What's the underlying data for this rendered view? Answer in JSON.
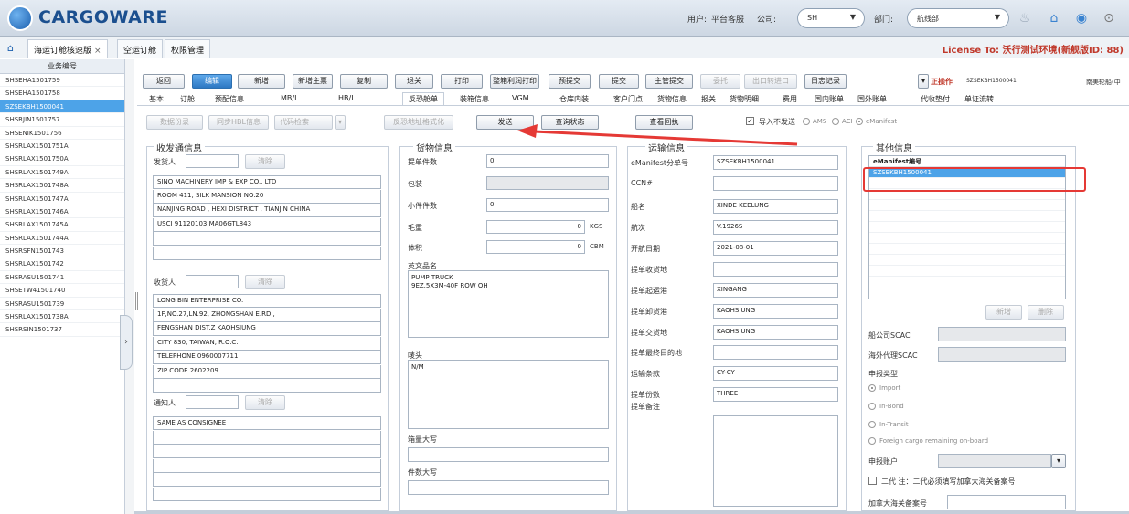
{
  "app": {
    "name": "CARGOWARE"
  },
  "topbar": {
    "user_label": "用户:",
    "user_value": "平台客服",
    "company_label": "公司:",
    "company_value": "SH",
    "dept_label": "部门:",
    "dept_value": "航线部"
  },
  "tabs": [
    {
      "label": "海运订舱核速版"
    },
    {
      "label": "空运订舱"
    },
    {
      "label": "权限管理"
    }
  ],
  "license": "License To: 沃行测试环境(新舰版ID: 88)",
  "left_list": {
    "header": "业务编号",
    "rows": [
      "SHSEHA1501759",
      "SHSEHA1501758",
      "SZSEKBH1500041",
      "SHSRJIN1501757",
      "SHSENIK1501756",
      "SHSRLAX1501751A",
      "SHSRLAX1501750A",
      "SHSRLAX1501749A",
      "SHSRLAX1501748A",
      "SHSRLAX1501747A",
      "SHSRLAX1501746A",
      "SHSRLAX1501745A",
      "SHSRLAX1501744A",
      "SHSRSFN1501743",
      "SHSRLAX1501742",
      "SHSRASU1501741",
      "SHSETW41501740",
      "SHSRASU1501739",
      "SHSRLAX1501738A",
      "SHSRSIN1501737"
    ],
    "selected_index": 2
  },
  "toolbar": {
    "buttons": [
      "返回",
      "编辑",
      "新增",
      "新增主票",
      "复制",
      "退关",
      "打印",
      "整箱利润打印",
      "预提交",
      "提交",
      "主管提交",
      "委托",
      "出口转进口",
      "日志记录"
    ],
    "op_label": "正操作",
    "ref": "SZSEKBH1500041",
    "carrier": "南美轮船(中"
  },
  "subtabs": [
    "基本",
    "订舱",
    "预配信息",
    "MB/L",
    "HB/L",
    "反恐舱单",
    "装箱信息",
    "VGM",
    "仓库内装",
    "客户门点",
    "货物信息",
    "报关",
    "货物明细",
    "费用",
    "国内账单",
    "国外账单",
    "代收垫付",
    "单证流转"
  ],
  "action_bar": {
    "btn_data": "数据份录",
    "btn_sync": "同步HBL信息",
    "btn_code": "代码检索",
    "btn_format": "反恐地址格式化",
    "btn_send": "发送",
    "btn_query": "查询状态",
    "btn_receipt": "查看回执",
    "chk_label": "导入不发送",
    "radio_ams": "AMS",
    "radio_aci": "ACI",
    "radio_emanifest": "eManifest"
  },
  "shipper_section": {
    "title": "收发通信息",
    "shipper_label": "发货人",
    "clear": "清除",
    "shipper_lines": [
      "SINO MACHINERY IMP & EXP CO., LTD",
      "ROOM 411, SILK MANSION NO.20",
      "NANJING ROAD , HEXI DISTRICT , TIANJIN CHINA",
      "USCI 91120103 MA06GTL843"
    ],
    "consignee_label": "收货人",
    "consignee_lines": [
      "LONG BIN ENTERPRISE CO.",
      "1F,NO.27,LN.92, ZHONGSHAN E.RD.,",
      "FENGSHAN DIST.Z KAOHSIUNG",
      "CITY 830, TAIWAN, R.O.C.",
      "TELEPHONE 0960007711",
      "ZIP CODE 2602209"
    ],
    "notify_label": "通知人",
    "notify_lines": [
      "SAME AS CONSIGNEE"
    ]
  },
  "cargo_section": {
    "title": "货物信息",
    "pieces_label": "提单件数",
    "pieces": "0",
    "pack_label": "包装",
    "small_pieces_label": "小件件数",
    "small_pieces": "0",
    "weight_label": "毛重",
    "weight": "0",
    "weight_unit": "KGS",
    "volume_label": "体积",
    "volume": "0",
    "volume_unit": "CBM",
    "desc_label": "英文品名",
    "desc": "PUMP TRUCK\n9EZ.5X3M-40F ROW OH",
    "marks_label": "唛头",
    "marks": "N/M",
    "box_upper_label": "箱量大写",
    "pieces_upper_label": "件数大写"
  },
  "transport_section": {
    "title": "运输信息",
    "emanifest_label": "eManifest分单号",
    "emanifest": "SZSEKBH1500041",
    "ccn_label": "CCN#",
    "vessel_label": "船名",
    "vessel": "XINDE KEELUNG",
    "voyage_label": "航次",
    "voyage": "V.1926S",
    "etd_label": "开航日期",
    "etd": "2021-08-01",
    "receipt_label": "提单收货地",
    "pol_label": "提单起运港",
    "pol": "XINGANG",
    "pod_label": "提单卸货港",
    "pod": "KAOHSIUNG",
    "delivery_label": "提单交货地",
    "delivery": "KAOHSIUNG",
    "final_label": "提单最终目的地",
    "terms_label": "运输条款",
    "terms": "CY-CY",
    "copies_label": "提单份数",
    "copies": "THREE",
    "remark_label": "提单备注"
  },
  "other_section": {
    "title": "其他信息",
    "list_header": "eManifest编号",
    "list_rows": [
      "SZSEKBH1500041"
    ],
    "btn_add": "新增",
    "btn_del": "删除",
    "carrier_scac_label": "船公司SCAC",
    "agent_scac_label": "海外代理SCAC",
    "decl_type_label": "申报类型",
    "types": [
      "Import",
      "In-Bond",
      "In-Transit",
      "Foreign cargo remaining on-board"
    ],
    "account_label": "申报账户",
    "second_label": "二代 注：二代必须填写加拿大海关备案号",
    "customs_label": "加拿大海关备案号"
  },
  "colors": {
    "accent": "#2d78c3",
    "highlight": "#e53935",
    "selected": "#4da3e8"
  }
}
